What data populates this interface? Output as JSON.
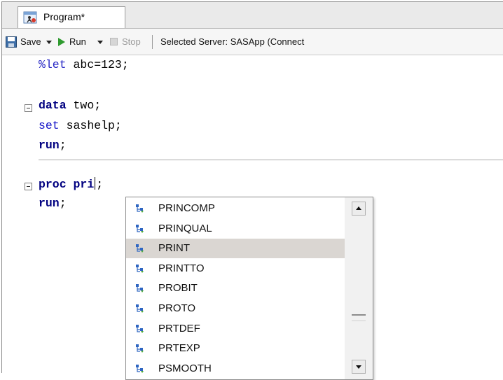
{
  "tab": {
    "label": "Program*",
    "icon": "program-icon"
  },
  "toolbar": {
    "save_label": "Save",
    "run_label": "Run",
    "stop_label": "Stop",
    "server_label": "Selected Server: SASApp (Connect",
    "icons": {
      "save": "save-icon",
      "run": "run-icon",
      "stop": "stop-icon"
    },
    "colors": {
      "run": "#2e9a2e",
      "stop_disabled": "#b9b9b9"
    }
  },
  "code": {
    "line1": {
      "macro": "%let",
      "rest": " abc=123;"
    },
    "line2": {
      "kw": "data",
      "rest": " two;"
    },
    "line3": {
      "kw": "set",
      "rest": " sashelp;"
    },
    "line4": {
      "kw": "run",
      "rest": ";"
    },
    "line5": {
      "kw": "proc",
      "sp": " ",
      "typed": "pri",
      "rest": ";"
    },
    "line6": {
      "kw": "run",
      "rest": ";"
    }
  },
  "autocomplete": {
    "items": [
      "PRINCOMP",
      "PRINQUAL",
      "PRINT",
      "PRINTTO",
      "PROBIT",
      "PROTO",
      "PRTDEF",
      "PRTEXP",
      "PSMOOTH"
    ],
    "selected": "PRINT"
  }
}
